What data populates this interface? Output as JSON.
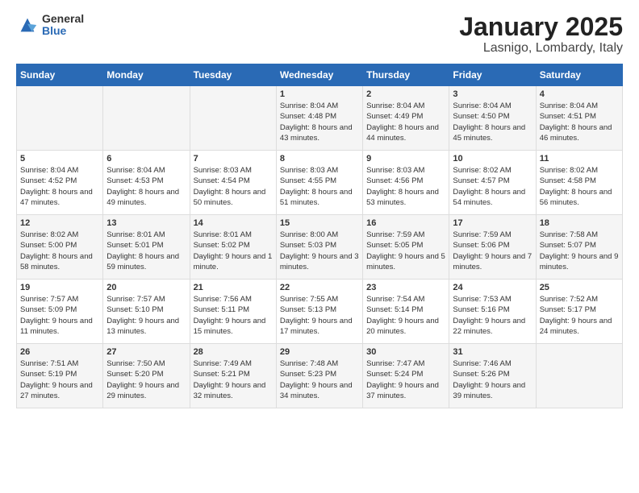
{
  "logo": {
    "general": "General",
    "blue": "Blue"
  },
  "title": "January 2025",
  "subtitle": "Lasnigo, Lombardy, Italy",
  "weekdays": [
    "Sunday",
    "Monday",
    "Tuesday",
    "Wednesday",
    "Thursday",
    "Friday",
    "Saturday"
  ],
  "weeks": [
    [
      {
        "day": "",
        "info": ""
      },
      {
        "day": "",
        "info": ""
      },
      {
        "day": "",
        "info": ""
      },
      {
        "day": "1",
        "info": "Sunrise: 8:04 AM\nSunset: 4:48 PM\nDaylight: 8 hours\nand 43 minutes."
      },
      {
        "day": "2",
        "info": "Sunrise: 8:04 AM\nSunset: 4:49 PM\nDaylight: 8 hours\nand 44 minutes."
      },
      {
        "day": "3",
        "info": "Sunrise: 8:04 AM\nSunset: 4:50 PM\nDaylight: 8 hours\nand 45 minutes."
      },
      {
        "day": "4",
        "info": "Sunrise: 8:04 AM\nSunset: 4:51 PM\nDaylight: 8 hours\nand 46 minutes."
      }
    ],
    [
      {
        "day": "5",
        "info": "Sunrise: 8:04 AM\nSunset: 4:52 PM\nDaylight: 8 hours\nand 47 minutes."
      },
      {
        "day": "6",
        "info": "Sunrise: 8:04 AM\nSunset: 4:53 PM\nDaylight: 8 hours\nand 49 minutes."
      },
      {
        "day": "7",
        "info": "Sunrise: 8:03 AM\nSunset: 4:54 PM\nDaylight: 8 hours\nand 50 minutes."
      },
      {
        "day": "8",
        "info": "Sunrise: 8:03 AM\nSunset: 4:55 PM\nDaylight: 8 hours\nand 51 minutes."
      },
      {
        "day": "9",
        "info": "Sunrise: 8:03 AM\nSunset: 4:56 PM\nDaylight: 8 hours\nand 53 minutes."
      },
      {
        "day": "10",
        "info": "Sunrise: 8:02 AM\nSunset: 4:57 PM\nDaylight: 8 hours\nand 54 minutes."
      },
      {
        "day": "11",
        "info": "Sunrise: 8:02 AM\nSunset: 4:58 PM\nDaylight: 8 hours\nand 56 minutes."
      }
    ],
    [
      {
        "day": "12",
        "info": "Sunrise: 8:02 AM\nSunset: 5:00 PM\nDaylight: 8 hours\nand 58 minutes."
      },
      {
        "day": "13",
        "info": "Sunrise: 8:01 AM\nSunset: 5:01 PM\nDaylight: 8 hours\nand 59 minutes."
      },
      {
        "day": "14",
        "info": "Sunrise: 8:01 AM\nSunset: 5:02 PM\nDaylight: 9 hours\nand 1 minute."
      },
      {
        "day": "15",
        "info": "Sunrise: 8:00 AM\nSunset: 5:03 PM\nDaylight: 9 hours\nand 3 minutes."
      },
      {
        "day": "16",
        "info": "Sunrise: 7:59 AM\nSunset: 5:05 PM\nDaylight: 9 hours\nand 5 minutes."
      },
      {
        "day": "17",
        "info": "Sunrise: 7:59 AM\nSunset: 5:06 PM\nDaylight: 9 hours\nand 7 minutes."
      },
      {
        "day": "18",
        "info": "Sunrise: 7:58 AM\nSunset: 5:07 PM\nDaylight: 9 hours\nand 9 minutes."
      }
    ],
    [
      {
        "day": "19",
        "info": "Sunrise: 7:57 AM\nSunset: 5:09 PM\nDaylight: 9 hours\nand 11 minutes."
      },
      {
        "day": "20",
        "info": "Sunrise: 7:57 AM\nSunset: 5:10 PM\nDaylight: 9 hours\nand 13 minutes."
      },
      {
        "day": "21",
        "info": "Sunrise: 7:56 AM\nSunset: 5:11 PM\nDaylight: 9 hours\nand 15 minutes."
      },
      {
        "day": "22",
        "info": "Sunrise: 7:55 AM\nSunset: 5:13 PM\nDaylight: 9 hours\nand 17 minutes."
      },
      {
        "day": "23",
        "info": "Sunrise: 7:54 AM\nSunset: 5:14 PM\nDaylight: 9 hours\nand 20 minutes."
      },
      {
        "day": "24",
        "info": "Sunrise: 7:53 AM\nSunset: 5:16 PM\nDaylight: 9 hours\nand 22 minutes."
      },
      {
        "day": "25",
        "info": "Sunrise: 7:52 AM\nSunset: 5:17 PM\nDaylight: 9 hours\nand 24 minutes."
      }
    ],
    [
      {
        "day": "26",
        "info": "Sunrise: 7:51 AM\nSunset: 5:19 PM\nDaylight: 9 hours\nand 27 minutes."
      },
      {
        "day": "27",
        "info": "Sunrise: 7:50 AM\nSunset: 5:20 PM\nDaylight: 9 hours\nand 29 minutes."
      },
      {
        "day": "28",
        "info": "Sunrise: 7:49 AM\nSunset: 5:21 PM\nDaylight: 9 hours\nand 32 minutes."
      },
      {
        "day": "29",
        "info": "Sunrise: 7:48 AM\nSunset: 5:23 PM\nDaylight: 9 hours\nand 34 minutes."
      },
      {
        "day": "30",
        "info": "Sunrise: 7:47 AM\nSunset: 5:24 PM\nDaylight: 9 hours\nand 37 minutes."
      },
      {
        "day": "31",
        "info": "Sunrise: 7:46 AM\nSunset: 5:26 PM\nDaylight: 9 hours\nand 39 minutes."
      },
      {
        "day": "",
        "info": ""
      }
    ]
  ]
}
